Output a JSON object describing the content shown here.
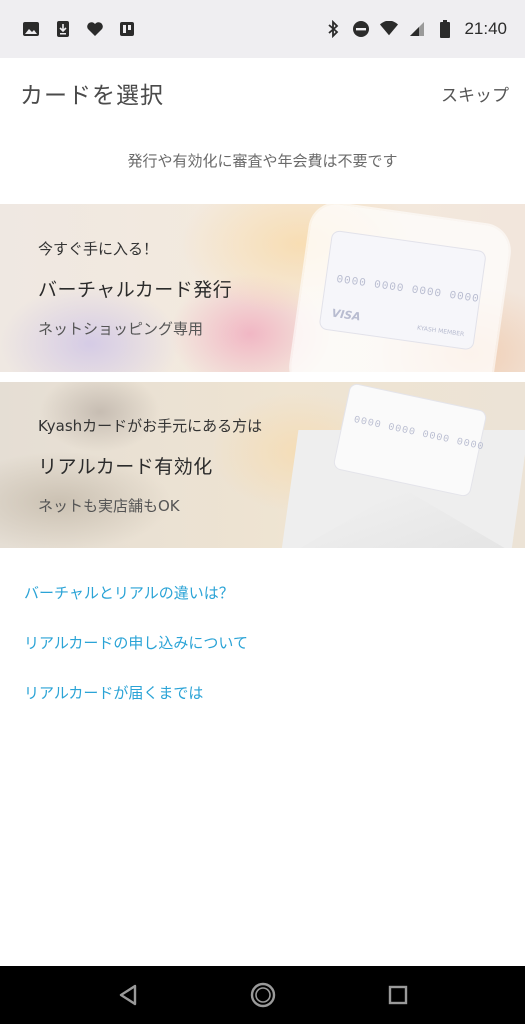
{
  "status_bar": {
    "time": "21:40",
    "left_icons": [
      "image-icon",
      "download-icon",
      "heart-icon",
      "book-icon"
    ],
    "right_icons": [
      "bluetooth-icon",
      "do-not-disturb-icon",
      "wifi-icon",
      "signal-icon",
      "battery-icon"
    ]
  },
  "header": {
    "title": "カードを選択",
    "skip_label": "スキップ"
  },
  "subtitle": "発行や有効化に審査や年会費は不要です",
  "banners": [
    {
      "kicker": "今すぐ手に入る！",
      "title": "バーチャルカード発行",
      "description": "ネットショッピング専用",
      "card_number": "0000 0000 0000 0000",
      "card_brand": "VISA",
      "card_member": "KYASH MEMBER"
    },
    {
      "kicker": "Kyashカードがお手元にある方は",
      "title": "リアルカード有効化",
      "description": "ネットも実店舗もOK",
      "card_number": "0000 0000 0000 0000"
    }
  ],
  "links": [
    "バーチャルとリアルの違いは？",
    "リアルカードの申し込みについて",
    "リアルカードが届くまでは"
  ],
  "colors": {
    "link": "#2aa3d6",
    "status_bar": "#efeef1",
    "nav_bar": "#000000"
  }
}
